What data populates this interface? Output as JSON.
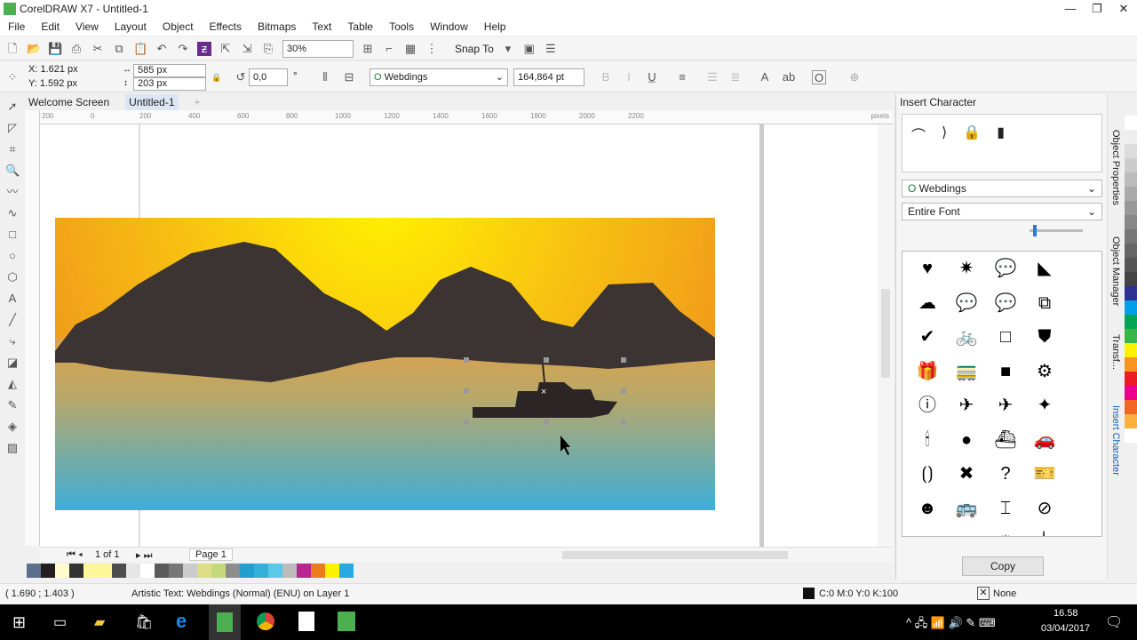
{
  "window": {
    "title": "CorelDRAW X7 - Untitled-1",
    "controls": [
      "—",
      "❐",
      "✕"
    ]
  },
  "menu": [
    "File",
    "Edit",
    "View",
    "Layout",
    "Object",
    "Effects",
    "Bitmaps",
    "Text",
    "Table",
    "Tools",
    "Window",
    "Help"
  ],
  "toolbar": {
    "zoom": "30%",
    "snap_to": "Snap To"
  },
  "propbar": {
    "x": "X: 1.621 px",
    "y": "Y: 1.592 px",
    "w": "585 px",
    "h": "203 px",
    "angle": "0,0",
    "angle_unit": "°",
    "font": "Webdings",
    "size": "164,864 pt"
  },
  "tabs": [
    "Welcome Screen",
    "Untitled-1",
    "+"
  ],
  "ruler": {
    "ticks": [
      "200",
      "0",
      "200",
      "400",
      "600",
      "800",
      "1000",
      "1200",
      "1400",
      "1600",
      "1800",
      "2000",
      "2200"
    ],
    "unit": "pixels"
  },
  "page_nav": {
    "count": "1 of 1",
    "page": "Page 1"
  },
  "palette": [
    "#5c6f8c",
    "#231f20",
    "#fffbcc",
    "#333",
    "#fff799",
    "#fff799",
    "#4d4d4d",
    "#e6e6e6",
    "#fff",
    "#5a5a5a",
    "#777",
    "#ccc",
    "#dede86",
    "#c6d97a",
    "#8c8c8c",
    "#21a0d0",
    "#35b0d8",
    "#5ac8e8",
    "#bbb",
    "#b8258c",
    "#ec7c1c",
    "#fff200",
    "#27aae1"
  ],
  "status": {
    "coords": "( 1.690 ; 1.403 )",
    "info": "Artistic Text: Webdings (Normal) (ENU) on Layer 1",
    "fill": "C:0 M:0 Y:0 K:100",
    "outline": "None"
  },
  "docker": {
    "title": "Insert Character",
    "preview": [
      "⌒",
      "⟩",
      "🔒",
      "▮"
    ],
    "font": "Webdings",
    "subset": "Entire Font",
    "copy": "Copy",
    "glyphs": [
      "♥",
      "✷",
      "💬",
      "◣",
      "☁",
      "💬",
      "💬",
      "⧉",
      "✔",
      "🚲",
      "□",
      "⛊",
      "🎁",
      "🚃",
      "■",
      "⚙",
      "ⓘ",
      "✈",
      "✈",
      "✦",
      "🕯",
      "●",
      "⛴",
      "🚗",
      "⟮⟯",
      "✖",
      "?",
      "🎫",
      "☻",
      "🚌",
      "⌶",
      "⊘",
      "◠",
      "⊗",
      "✹",
      "│"
    ]
  },
  "vtabs": [
    "Object Properties",
    "Object Manager",
    "Transf...",
    "Insert Character"
  ],
  "rpalette": [
    "#fff",
    "#eee",
    "#ddd",
    "#ccc",
    "#bbb",
    "#aaa",
    "#999",
    "#888",
    "#777",
    "#666",
    "#555",
    "#444",
    "#2d3192",
    "#00a0e9",
    "#00a651",
    "#39b54a",
    "#fff200",
    "#f7941d",
    "#ed1c24",
    "#ec008c",
    "#f26522",
    "#fbb040",
    "#fff"
  ],
  "taskbar": {
    "time": "16.58",
    "date": "03/04/2017"
  }
}
